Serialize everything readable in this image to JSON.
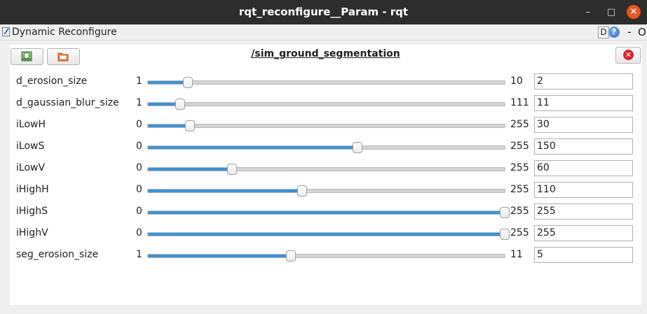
{
  "window": {
    "title": "rqt_reconfigure__Param - rqt",
    "minimize_glyph": "–",
    "maximize_glyph": "□",
    "close_glyph": "×"
  },
  "dock": {
    "title": "Dynamic Reconfigure",
    "d_label": "D",
    "help_label": "?",
    "dash_label": "-",
    "o_label": "O"
  },
  "panel": {
    "node_name": "/sim_ground_segmentation",
    "close_glyph": "✕"
  },
  "params": [
    {
      "name": "d_erosion_size",
      "min": "1",
      "max": "10",
      "value": "2"
    },
    {
      "name": "d_gaussian_blur_size",
      "min": "1",
      "max": "111",
      "value": "11"
    },
    {
      "name": "iLowH",
      "min": "0",
      "max": "255",
      "value": "30"
    },
    {
      "name": "iLowS",
      "min": "0",
      "max": "255",
      "value": "150"
    },
    {
      "name": "iLowV",
      "min": "0",
      "max": "255",
      "value": "60"
    },
    {
      "name": "iHighH",
      "min": "0",
      "max": "255",
      "value": "110"
    },
    {
      "name": "iHighS",
      "min": "0",
      "max": "255",
      "value": "255"
    },
    {
      "name": "iHighV",
      "min": "0",
      "max": "255",
      "value": "255"
    },
    {
      "name": "seg_erosion_size",
      "min": "1",
      "max": "11",
      "value": "5"
    }
  ],
  "colors": {
    "slider_fill": "#3b93d6",
    "titlebar": "#2d2d2d",
    "close_button": "#e95420"
  }
}
